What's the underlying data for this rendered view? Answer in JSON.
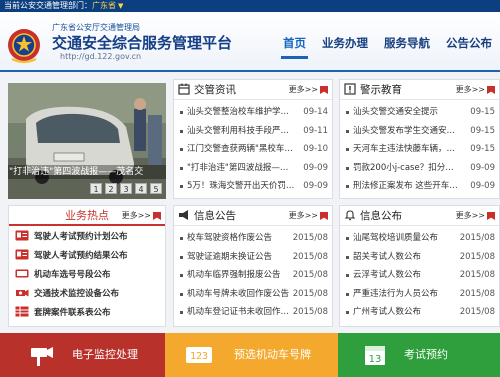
{
  "topbar": {
    "text": "当前公安交通管理部门：",
    "province": "广东省"
  },
  "header": {
    "org": "广东省公安厅交通管理局",
    "title": "交通安全综合服务管理平台",
    "url": "http://gd.122.gov.cn"
  },
  "nav": [
    "首页",
    "业务办理",
    "服务导航",
    "公告公布"
  ],
  "carousel": {
    "caption": "\"打非治违\"第四波战报——茂名交",
    "pages": [
      "1",
      "2",
      "3",
      "4",
      "5"
    ]
  },
  "more_label": "更多>>",
  "news": {
    "title": "交管资讯",
    "items": [
      {
        "text": "汕头交警整治校车维护学生…",
        "date": "09-14"
      },
      {
        "text": "汕头交警利用科技手段严查…",
        "date": "09-11"
      },
      {
        "text": "江门交警查获两辆\"黑校车…",
        "date": "09-10"
      },
      {
        "text": "\"打非治违\"第四波战报—…",
        "date": "09-09"
      },
      {
        "text": "5万！珠海交警开出天价罚单…",
        "date": "09-09"
      }
    ]
  },
  "alerts": {
    "title": "警示教育",
    "items": [
      {
        "text": "汕头交警交通安全提示",
        "date": "09-15"
      },
      {
        "text": "汕头交警发布学生交通安全…",
        "date": "09-15"
      },
      {
        "text": "天河车主违法快藤车辆，死者…",
        "date": "09-15"
      },
      {
        "text": "罚款200小j-case？扣分重考…",
        "date": "09-09"
      },
      {
        "text": "刑法修正案发布 这些开车…",
        "date": "09-09"
      }
    ]
  },
  "hot": {
    "title": "业务热点",
    "items": [
      "驾驶人考试预约计划公布",
      "驾驶人考试预约结果公布",
      "机动车选号号段公布",
      "交通技术监控设备公布",
      "套牌案件联系表公布"
    ]
  },
  "notices": {
    "title": "信息公告",
    "items": [
      {
        "text": "校车驾驶资格作废公告",
        "date": "2015/08"
      },
      {
        "text": "驾驶证逾期未换证公告",
        "date": "2015/08"
      },
      {
        "text": "机动车临界强制报废公告",
        "date": "2015/08"
      },
      {
        "text": "机动车号牌未收回作废公告",
        "date": "2015/08"
      },
      {
        "text": "机动车登记证书未收回作废…",
        "date": "2015/08"
      }
    ]
  },
  "announcements": {
    "title": "信息公布",
    "items": [
      {
        "text": "汕尾驾校培训质量公布",
        "date": "2015/08"
      },
      {
        "text": "韶关考试人数公布",
        "date": "2015/08"
      },
      {
        "text": "云浮考试人数公布",
        "date": "2015/08"
      },
      {
        "text": "严重违法行为人员公布",
        "date": "2015/08"
      },
      {
        "text": "广州考试人数公布",
        "date": "2015/08"
      }
    ]
  },
  "bottom": {
    "b1": "电子监控处理",
    "b2": "预选机动车号牌",
    "b3": "考试预约",
    "plate_digits": "123",
    "calendar_day": "13"
  },
  "colors": {
    "nav_blue": "#1a63b6",
    "red": "#b9312b",
    "orange": "#f4a92e",
    "green": "#2e9f3c"
  }
}
